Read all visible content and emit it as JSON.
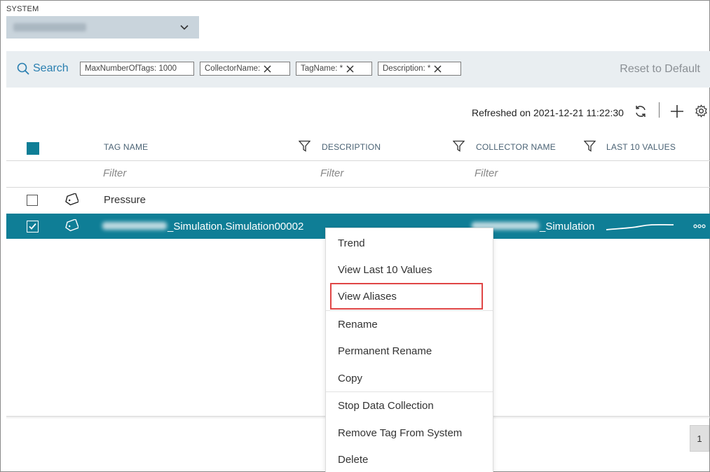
{
  "system": {
    "label": "SYSTEM"
  },
  "search": {
    "label": "Search",
    "chips": [
      {
        "text": "MaxNumberOfTags: 1000"
      },
      {
        "text": "CollectorName:"
      },
      {
        "text": "TagName: *"
      },
      {
        "text": "Description: *"
      }
    ],
    "reset_label": "Reset to Default"
  },
  "toolbar": {
    "refreshed": "Refreshed on 2021-12-21 11:22:30"
  },
  "table": {
    "columns": [
      "TAG NAME",
      "DESCRIPTION",
      "COLLECTOR NAME",
      "LAST 10 VALUES"
    ],
    "filter_placeholder": "Filter",
    "rows": [
      {
        "tag_name": "Pressure",
        "checked": false
      },
      {
        "tag_name": "_Simulation.Simulation00002",
        "collector": "_Simulation",
        "checked": true
      }
    ]
  },
  "context_menu": {
    "items": [
      "Trend",
      "View Last 10 Values",
      "View Aliases",
      "Rename",
      "Permanent Rename",
      "Copy",
      "Stop Data Collection",
      "Remove Tag From System",
      "Delete"
    ],
    "highlighted": "View Aliases"
  },
  "pagination": {
    "current_page": "1"
  },
  "colors": {
    "accent": "#0f7e96",
    "link": "#2a7fb0",
    "highlight_border": "#e04646"
  }
}
